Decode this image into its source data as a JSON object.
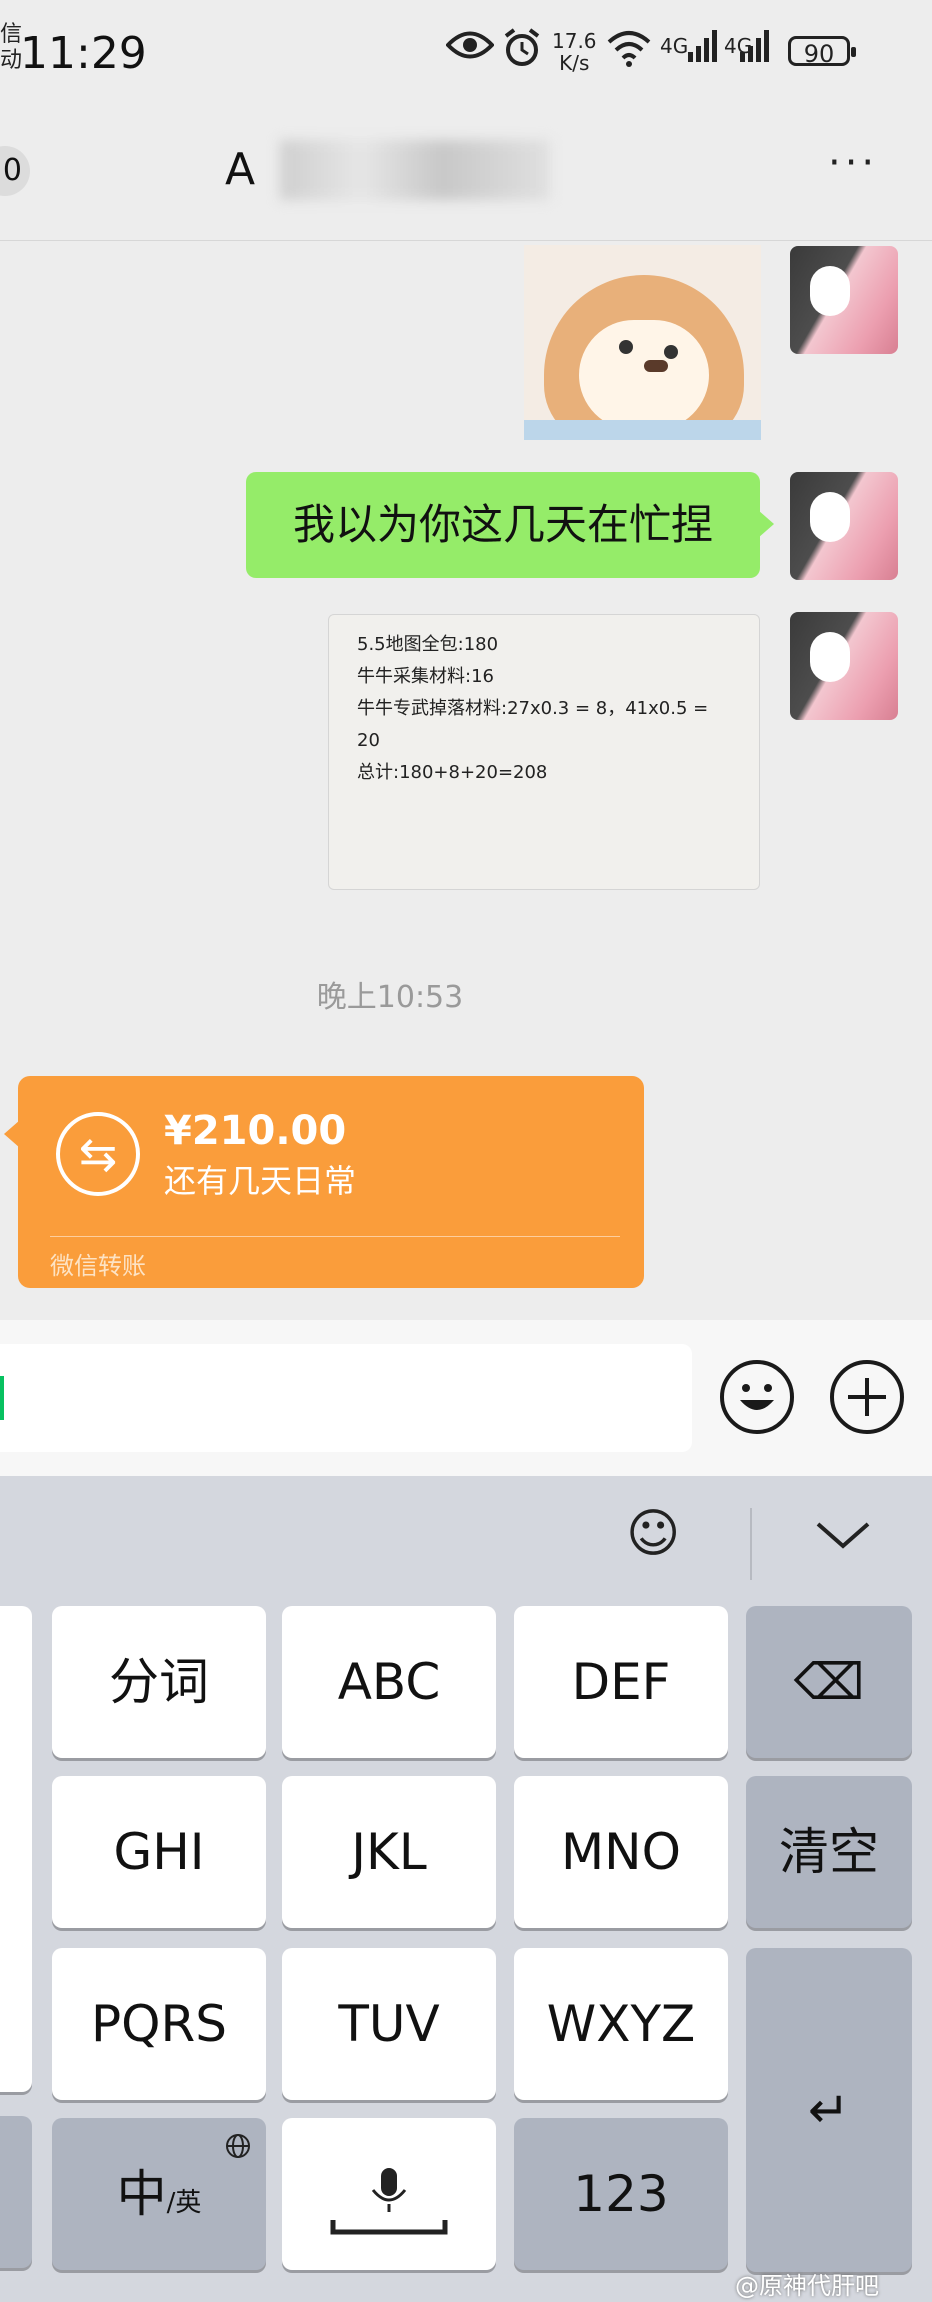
{
  "status_bar": {
    "left_chars": "信\n动",
    "time": "11:29",
    "speed_value": "17.6",
    "speed_unit": "K/s",
    "network1": "4G",
    "network2": "4G",
    "battery": "90",
    "icons": [
      "eye-icon",
      "alarm-icon",
      "wifi-icon",
      "signal-icon",
      "signal-icon",
      "battery-icon"
    ]
  },
  "header": {
    "back_badge": "0",
    "title": "A",
    "more": "···"
  },
  "messages": {
    "green_text": "我以为你这几天在忙捏",
    "note_lines": [
      "5.5地图全包:180",
      "牛牛采集材料:16",
      "牛牛专武掉落材料:27x0.3 = 8，41x0.5 = 20",
      "总计:180+8+20=208"
    ],
    "timestamp": "晚上10:53",
    "transfer": {
      "amount": "¥210.00",
      "note": "还有几天日常",
      "label": "微信转账"
    }
  },
  "input_bar": {
    "emoji_icon": "☺",
    "plus_icon": "+"
  },
  "keyboard": {
    "keys_row1": [
      "分词",
      "ABC",
      "DEF"
    ],
    "keys_row2": [
      "GHI",
      "JKL",
      "MNO"
    ],
    "keys_row3": [
      "PQRS",
      "TUV",
      "WXYZ"
    ],
    "backspace": "⌫",
    "clear": "清空",
    "lang_main": "中",
    "lang_sub": "/英",
    "num": "123",
    "enter": "↵",
    "emoji": "☺",
    "collapse": "⌄"
  },
  "watermark": "@原神代肝吧"
}
